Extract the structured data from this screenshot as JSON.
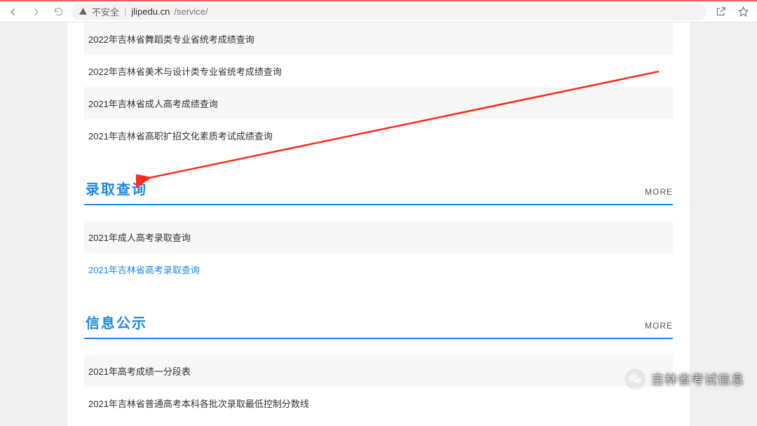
{
  "browser": {
    "insecure_label": "不安全",
    "host": "jlipedu.cn",
    "path": "/service/"
  },
  "sections": {
    "score_query": {
      "items": [
        "2022年吉林省舞蹈类专业省统考成绩查询",
        "2022年吉林省美术与设计类专业省统考成绩查询",
        "2021年吉林省成人高考成绩查询",
        "2021年吉林省高职扩招文化素质考试成绩查询"
      ]
    },
    "admission_query": {
      "title": "录取查询",
      "more": "MORE",
      "items": [
        {
          "label": "2021年成人高考录取查询",
          "hot": false
        },
        {
          "label": "2021年吉林省高考录取查询",
          "hot": true
        }
      ]
    },
    "info_publicity": {
      "title": "信息公示",
      "more": "MORE",
      "items": [
        "2021年高考成绩一分段表",
        "2021年吉林省普通高考本科各批次录取最低控制分数线"
      ]
    }
  },
  "watermark": {
    "text": "吉林省考试信息"
  }
}
